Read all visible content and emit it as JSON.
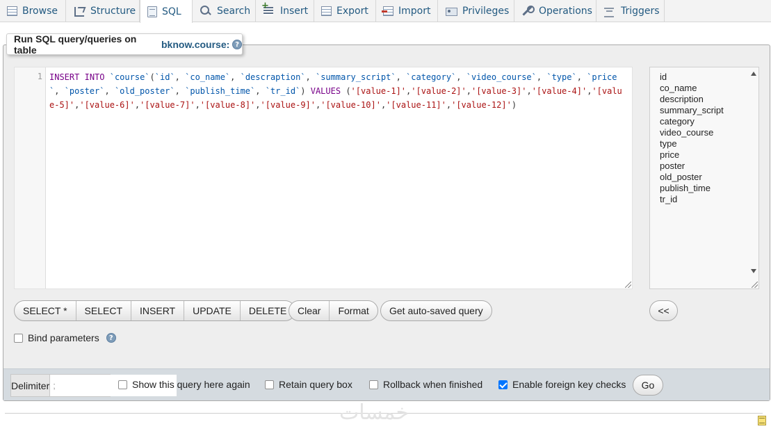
{
  "tabs": [
    {
      "label": "Browse",
      "icon": "browse-icon"
    },
    {
      "label": "Structure",
      "icon": "structure-icon"
    },
    {
      "label": "SQL",
      "icon": "sql-icon",
      "active": true
    },
    {
      "label": "Search",
      "icon": "search-icon"
    },
    {
      "label": "Insert",
      "icon": "insert-icon"
    },
    {
      "label": "Export",
      "icon": "export-icon"
    },
    {
      "label": "Import",
      "icon": "import-icon"
    },
    {
      "label": "Privileges",
      "icon": "privileges-icon"
    },
    {
      "label": "Operations",
      "icon": "operations-icon"
    },
    {
      "label": "Triggers",
      "icon": "triggers-icon"
    }
  ],
  "legend": {
    "prefix": "Run SQL query/queries on table",
    "table": "bknow.course:",
    "help_icon": "help-icon"
  },
  "editor": {
    "line_number": "1",
    "query": "INSERT INTO `course`(`id`, `co_name`, `descraption`, `summary_script`, `category`, `video_course`, `type`, `price`, `poster`, `old_poster`, `publish_time`, `tr_id`) VALUES ('[value-1]','[value-2]','[value-3]','[value-4]','[value-5]','[value-6]','[value-7]','[value-8]','[value-9]','[value-10]','[value-11]','[value-12]')",
    "keywords": [
      "INSERT",
      "INTO",
      "VALUES"
    ],
    "table": "course",
    "columns": [
      "id",
      "co_name",
      "descraption",
      "summary_script",
      "category",
      "video_course",
      "type",
      "price",
      "poster",
      "old_poster",
      "publish_time",
      "tr_id"
    ],
    "values": [
      "'[value-1]'",
      "'[value-2]'",
      "'[value-3]'",
      "'[value-4]'",
      "'[value-5]'",
      "'[value-6]'",
      "'[value-7]'",
      "'[value-8]'",
      "'[value-9]'",
      "'[value-10]'",
      "'[value-11]'",
      "'[value-12]'"
    ]
  },
  "column_list": [
    "id",
    "co_name",
    "description",
    "summary_script",
    "category",
    "video_course",
    "type",
    "price",
    "poster",
    "old_poster",
    "publish_time",
    "tr_id"
  ],
  "buttons": {
    "select_star": "SELECT *",
    "select": "SELECT",
    "insert": "INSERT",
    "update": "UPDATE",
    "delete": "DELETE",
    "clear": "Clear",
    "format": "Format",
    "autosaved": "Get auto-saved query",
    "insert_column": "<<",
    "go": "Go"
  },
  "bind_parameters": {
    "label": "Bind parameters",
    "checked": false
  },
  "footer": {
    "delimiter_label": "Delimiter",
    "delimiter_value": ";",
    "show_query": {
      "label": "Show this query here again",
      "checked": false
    },
    "retain_box": {
      "label": "Retain query box",
      "checked": false
    },
    "rollback": {
      "label": "Rollback when finished",
      "checked": false
    },
    "foreign_keys": {
      "label": "Enable foreign key checks",
      "checked": true
    }
  },
  "watermark": "خمسات",
  "colors": {
    "link": "#235a81",
    "keyword": "#770088",
    "identifier": "#0055aa",
    "string": "#aa1111",
    "checkbox_checked": "#0075ff"
  }
}
